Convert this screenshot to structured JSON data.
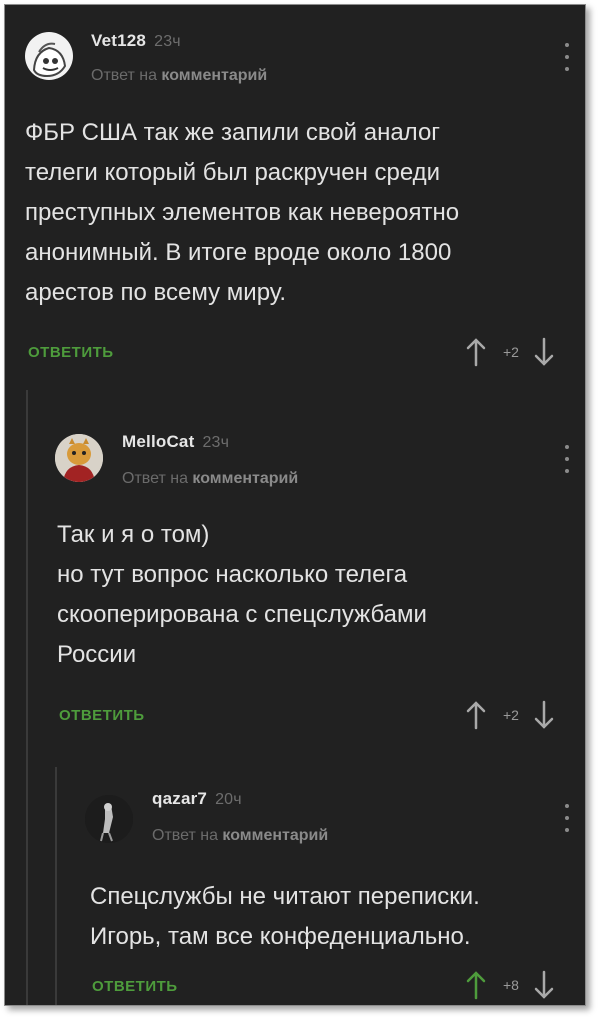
{
  "comments": [
    {
      "author": "Vet128",
      "time": "23ч",
      "reply_prefix": "Ответ на",
      "reply_target": "комментарий",
      "lines": [
        "ФБР США так же запили свой аналог",
        "телеги который был раскручен среди",
        "преступных элементов как невероятно",
        "анонимный. В итоге вроде около 1800",
        "арестов по всему миру."
      ],
      "reply_label": "ОТВЕТИТЬ",
      "score": "+2"
    },
    {
      "author": "MelloCat",
      "time": "23ч",
      "reply_prefix": "Ответ на",
      "reply_target": "комментарий",
      "lines": [
        "Так и я о том)",
        "но тут вопрос насколько телега",
        "скооперирована с спецслужбами",
        "России"
      ],
      "reply_label": "ОТВЕТИТЬ",
      "score": "+2"
    },
    {
      "author": "qazar7",
      "time": "20ч",
      "reply_prefix": "Ответ на",
      "reply_target": "комментарий",
      "lines": [
        "Спецслужбы не читают переписки.",
        "Игорь, там все конфеденциально."
      ],
      "reply_label": "ОТВЕТИТЬ",
      "score": "+8"
    }
  ],
  "colors": {
    "background": "#212121",
    "accent_green": "#4e9c3c",
    "text": "#e3e3e3",
    "muted": "#6b6b6b"
  },
  "icons": [
    "up-arrow-icon",
    "down-arrow-icon",
    "kebab-menu-icon"
  ]
}
